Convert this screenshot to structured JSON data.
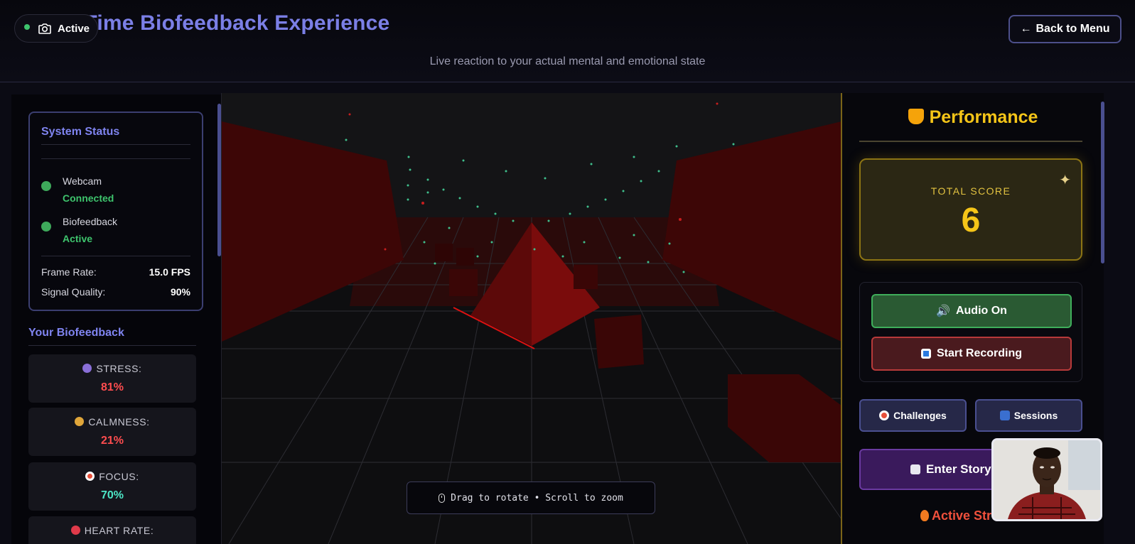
{
  "header": {
    "title": "Real-Time Biofeedback Experience",
    "subtitle": "Live reaction to your actual mental and emotional state",
    "camera_status": "Active",
    "back_button": "Back to Menu"
  },
  "system_status": {
    "title": "System Status",
    "webcam_label": "Webcam",
    "webcam_value": "Connected",
    "biofeedback_label": "Biofeedback",
    "biofeedback_value": "Active",
    "frame_rate_label": "Frame Rate:",
    "frame_rate_value": "15.0 FPS",
    "signal_quality_label": "Signal Quality:",
    "signal_quality_value": "90%"
  },
  "biofeedback": {
    "title": "Your Biofeedback",
    "items": [
      {
        "label": "STRESS:",
        "value": "81%",
        "color": "#ff4d4f"
      },
      {
        "label": "CALMNESS:",
        "value": "21%",
        "color": "#ff4d4f"
      },
      {
        "label": "FOCUS:",
        "value": "70%",
        "color": "#4de6c6"
      },
      {
        "label": "HEART RATE:",
        "value": ""
      }
    ]
  },
  "viewport": {
    "hint": "Drag to rotate • Scroll to zoom"
  },
  "performance": {
    "title": "Performance",
    "total_score_label": "TOTAL SCORE",
    "total_score_value": "6",
    "audio_button": "Audio On",
    "record_button": "Start Recording",
    "challenges_button": "Challenges",
    "sessions_button": "Sessions",
    "story_button": "Enter Story",
    "active_streak": "Active Str"
  },
  "colors": {
    "accent": "#7b7fe6",
    "gold": "#f5c518",
    "success": "#3ec46d",
    "danger": "#ff4d4f",
    "teal": "#4de6c6"
  }
}
